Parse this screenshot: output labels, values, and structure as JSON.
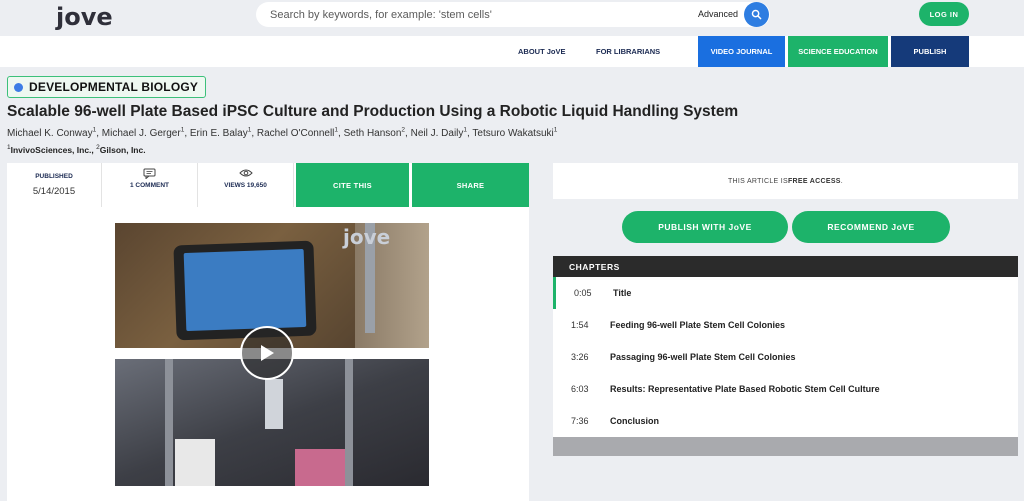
{
  "header": {
    "logo": "jove",
    "search_placeholder": "Search by keywords, for example: 'stem cells'",
    "advanced_label": "Advanced",
    "login_label": "LOG IN"
  },
  "nav": {
    "about": "ABOUT JoVE",
    "librarians": "FOR LIBRARIANS",
    "video_journal": "VIDEO JOURNAL",
    "science_education": "SCIENCE EDUCATION",
    "publish": "PUBLISH"
  },
  "article": {
    "category": "DEVELOPMENTAL BIOLOGY",
    "title": "Scalable 96-well Plate Based iPSC Culture and Production Using a Robotic Liquid Handling System",
    "authors": [
      {
        "name": "Michael K. Conway",
        "aff": "1"
      },
      {
        "name": "Michael J. Gerger",
        "aff": "1"
      },
      {
        "name": "Erin E. Balay",
        "aff": "1"
      },
      {
        "name": "Rachel O'Connell",
        "aff": "1"
      },
      {
        "name": "Seth Hanson",
        "aff": "2"
      },
      {
        "name": "Neil J. Daily",
        "aff": "1"
      },
      {
        "name": "Tetsuro Wakatsuki",
        "aff": "1"
      }
    ],
    "affiliations": [
      {
        "num": "1",
        "name": "InvivoSciences, Inc."
      },
      {
        "num": "2",
        "name": "Gilson, Inc."
      }
    ]
  },
  "stats": {
    "published_label": "PUBLISHED",
    "published_date": "5/14/2015",
    "comment_label": "1 COMMENT",
    "views_label": "VIEWS 19,650",
    "cite_label": "CITE THIS",
    "share_label": "SHARE"
  },
  "video": {
    "watermark": "jove"
  },
  "access": {
    "prefix": "THIS ARTICLE IS ",
    "bold": "FREE ACCESS",
    "suffix": "."
  },
  "buttons": {
    "publish_with": "PUBLISH WITH JoVE",
    "recommend": "RECOMMEND JoVE"
  },
  "chapters": {
    "heading": "CHAPTERS",
    "items": [
      {
        "time": "0:05",
        "name": "Title"
      },
      {
        "time": "1:54",
        "name": "Feeding 96-well Plate Stem Cell Colonies"
      },
      {
        "time": "3:26",
        "name": "Passaging 96-well Plate Stem Cell Colonies"
      },
      {
        "time": "6:03",
        "name": "Results: Representative Plate Based Robotic Stem Cell Culture"
      },
      {
        "time": "7:36",
        "name": "Conclusion"
      }
    ]
  },
  "colors": {
    "accent_green": "#1db36a",
    "nav_blue": "#1a6fe0",
    "nav_green": "#1db36a",
    "nav_navy": "#153a7a"
  }
}
